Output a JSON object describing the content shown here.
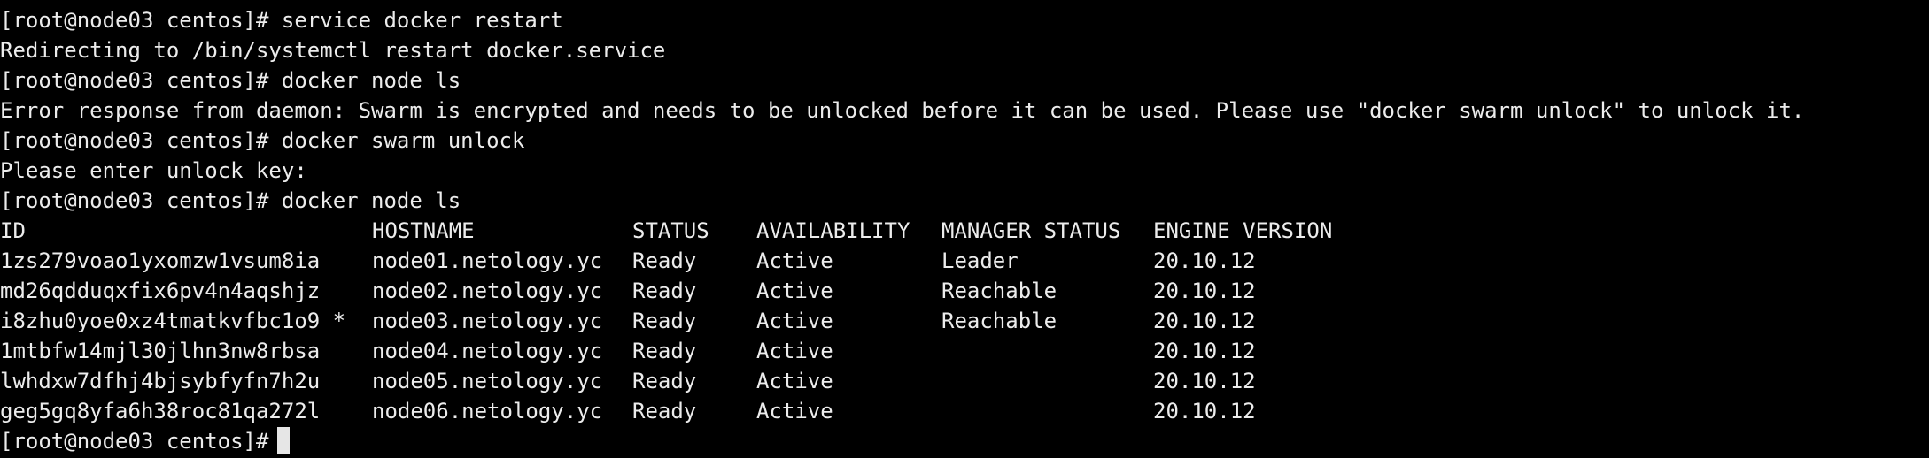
{
  "terminal": {
    "prompt": "[root@node03 centos]#",
    "lines": [
      {
        "kind": "command",
        "command": "service docker restart"
      },
      {
        "kind": "output",
        "text": "Redirecting to /bin/systemctl restart docker.service"
      },
      {
        "kind": "command",
        "command": "docker node ls"
      },
      {
        "kind": "output",
        "text": "Error response from daemon: Swarm is encrypted and needs to be unlocked before it can be used. Please use \"docker swarm unlock\" to unlock it."
      },
      {
        "kind": "command",
        "command": "docker swarm unlock"
      },
      {
        "kind": "output",
        "text": "Please enter unlock key:"
      },
      {
        "kind": "command",
        "command": "docker node ls"
      }
    ],
    "table": {
      "headers": {
        "id": "ID",
        "hostname": "HOSTNAME",
        "status": "STATUS",
        "availability": "AVAILABILITY",
        "manager_status": "MANAGER STATUS",
        "engine_version": "ENGINE VERSION"
      },
      "rows": [
        {
          "id": "1zs279voao1yxomzw1vsum8ia",
          "hostname": "node01.netology.yc",
          "status": "Ready",
          "availability": "Active",
          "manager_status": "Leader",
          "engine_version": "20.10.12"
        },
        {
          "id": "md26qdduqxfix6pv4n4aqshjz",
          "hostname": "node02.netology.yc",
          "status": "Ready",
          "availability": "Active",
          "manager_status": "Reachable",
          "engine_version": "20.10.12"
        },
        {
          "id": "i8zhu0yoe0xz4tmatkvfbc1o9 *",
          "hostname": "node03.netology.yc",
          "status": "Ready",
          "availability": "Active",
          "manager_status": "Reachable",
          "engine_version": "20.10.12"
        },
        {
          "id": "1mtbfw14mjl30jlhn3nw8rbsa",
          "hostname": "node04.netology.yc",
          "status": "Ready",
          "availability": "Active",
          "manager_status": "",
          "engine_version": "20.10.12"
        },
        {
          "id": "lwhdxw7dfhj4bjsybfyfn7h2u",
          "hostname": "node05.netology.yc",
          "status": "Ready",
          "availability": "Active",
          "manager_status": "",
          "engine_version": "20.10.12"
        },
        {
          "id": "geg5gq8yfa6h38roc81qa272l",
          "hostname": "node06.netology.yc",
          "status": "Ready",
          "availability": "Active",
          "manager_status": "",
          "engine_version": "20.10.12"
        }
      ]
    },
    "final_prompt": "[root@node03 centos]#",
    "colors": {
      "background": "#000000",
      "foreground": "#ececec",
      "cursor": "#e6e6e6"
    }
  }
}
